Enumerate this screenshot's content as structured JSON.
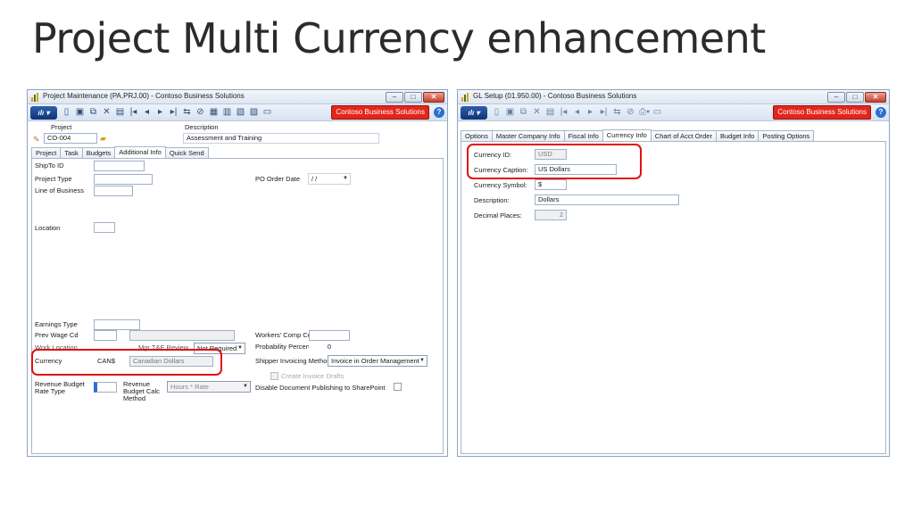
{
  "slide": {
    "title": "Project Multi Currency enhancement"
  },
  "left_window": {
    "title": "Project Maintenance (PA.PRJ.00) - Contoso Business Solutions",
    "company": "Contoso Business Solutions",
    "header": {
      "project_label": "Project",
      "project_value": "CO-004",
      "description_label": "Description",
      "description_value": "Assessment and Training"
    },
    "tabs": [
      "Project",
      "Task",
      "Budgets",
      "Additional Info",
      "Quick Send"
    ],
    "active_tab": "Additional Info",
    "fields": {
      "shipto_id": "ShipTo ID",
      "project_type": "Project Type",
      "line_of_business": "Line of Business",
      "location": "Location",
      "po_order_date_label": "PO Order Date",
      "po_order_date_value": "/ /",
      "earnings_type": "Earnings Type",
      "prev_wage_cd": "Prev Wage Cd",
      "work_location": "Work Location",
      "mgr_te_review": "Mgr T&E Review",
      "mgr_te_review_value": "Not Required",
      "currency_label": "Currency",
      "currency_code": "CAN$",
      "currency_desc": "Canadian Dollars",
      "workers_comp_cd": "Workers' Comp Cd",
      "probability_percent": "Probability Percent",
      "probability_value": "0",
      "shipper_invoicing_method": "Shipper Invoicing Method",
      "shipper_invoicing_value": "Invoice in Order Management",
      "create_invoice_drafts": "Create Invoice Drafts",
      "revenue_budget_rate_type": "Revenue Budget Rate Type",
      "revenue_budget_calc_method": "Revenue Budget Calc Method",
      "revenue_budget_calc_value": "Hours * Rate",
      "disable_doc_publishing": "Disable Document Publishing to SharePoint"
    }
  },
  "right_window": {
    "title": "GL Setup (01.950.00) - Contoso Business Solutions",
    "company": "Contoso Business Solutions",
    "tabs": [
      "Options",
      "Master Company Info",
      "Fiscal Info",
      "Currency Info",
      "Chart of Acct Order",
      "Budget Info",
      "Posting Options"
    ],
    "active_tab": "Currency Info",
    "fields": {
      "currency_id_label": "Currency ID:",
      "currency_id_value": "USD",
      "currency_caption_label": "Currency Caption:",
      "currency_caption_value": "US Dollars",
      "currency_symbol_label": "Currency Symbol:",
      "currency_symbol_value": "$",
      "description_label": "Description:",
      "description_value": "Dollars",
      "decimal_places_label": "Decimal Places:",
      "decimal_places_value": "2"
    }
  },
  "colors": {
    "highlight": "#e01010",
    "company_badge": "#e3261c",
    "toolbar": "#d7e2f0"
  },
  "icons": [
    "app-icon",
    "new-icon",
    "save-icon",
    "copy-icon",
    "delete-icon",
    "note-icon",
    "first-icon",
    "prev-icon",
    "next-icon",
    "last-icon",
    "print-icon",
    "help-icon"
  ]
}
